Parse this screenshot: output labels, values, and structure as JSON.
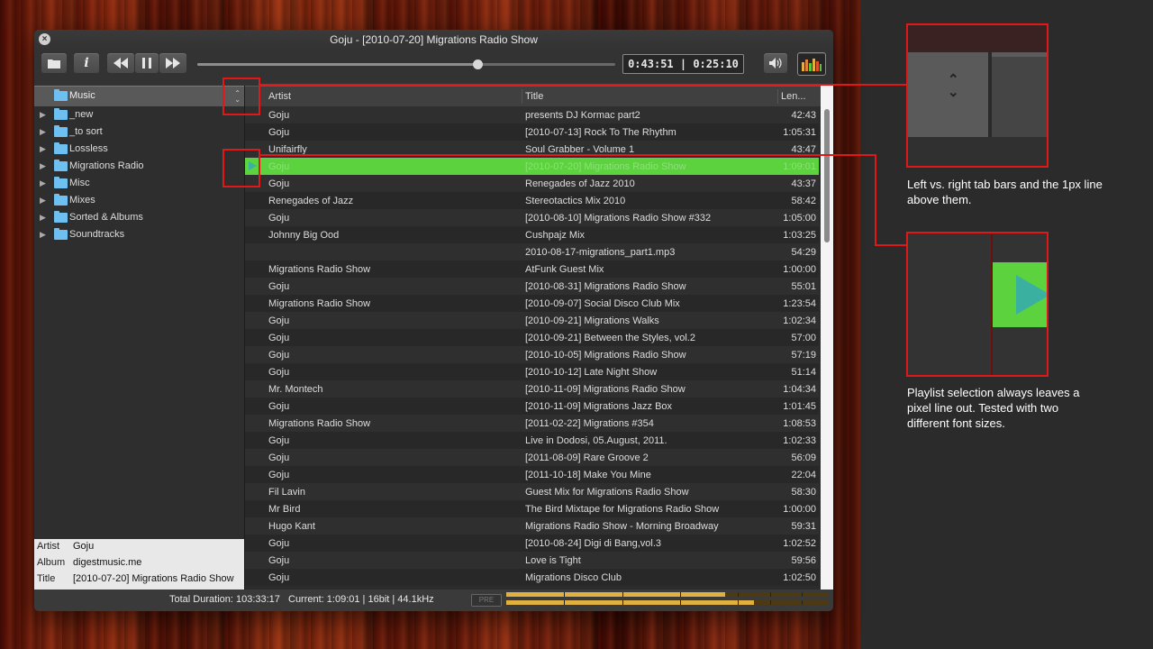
{
  "window": {
    "title": "Goju - [2010-07-20] Migrations Radio Show",
    "close_glyph": "×"
  },
  "toolbar": {
    "open_icon": "folder-icon",
    "info_icon": "info-icon",
    "prev_icon": "rewind-icon",
    "pause_icon": "pause-icon",
    "next_icon": "fast-forward-icon",
    "volume_icon": "speaker-icon",
    "visualizer_icon": "equalizer-icon",
    "seek_progress": 0.67,
    "time_display": "0:43:51 | 0:25:10"
  },
  "library": {
    "header_label": "Music",
    "items": [
      {
        "label": "_new"
      },
      {
        "label": "_to sort"
      },
      {
        "label": "Lossless"
      },
      {
        "label": "Migrations Radio"
      },
      {
        "label": "Misc"
      },
      {
        "label": "Mixes"
      },
      {
        "label": "Sorted & Albums"
      },
      {
        "label": "Soundtracks"
      }
    ]
  },
  "track_info": {
    "artist_key": "Artist",
    "artist_val": "Goju",
    "album_key": "Album",
    "album_val": "digestmusic.me",
    "title_key": "Title",
    "title_val": "[2010-07-20] Migrations Radio Show"
  },
  "playlist": {
    "columns": {
      "artist": "Artist",
      "title": "Title",
      "length": "Len..."
    },
    "rows": [
      {
        "artist": "Goju",
        "title": "presents DJ Kormac part2",
        "length": "42:43"
      },
      {
        "artist": "Goju",
        "title": "[2010-07-13] Rock To The Rhythm",
        "length": "1:05:31"
      },
      {
        "artist": "Unifairfly",
        "title": "Soul Grabber - Volume 1",
        "length": "43:47"
      },
      {
        "artist": "Goju",
        "title": "[2010-07-20] Migrations Radio Show",
        "length": "1:09:01"
      },
      {
        "artist": "Goju",
        "title": "Renegades of Jazz 2010",
        "length": "43:37"
      },
      {
        "artist": "Renegades of Jazz",
        "title": "Stereotactics Mix 2010",
        "length": "58:42"
      },
      {
        "artist": "Goju",
        "title": "[2010-08-10] Migrations Radio Show #332",
        "length": "1:05:00"
      },
      {
        "artist": "Johnny Big Ood",
        "title": "Cushpajz Mix",
        "length": "1:03:25"
      },
      {
        "artist": "",
        "title": "2010-08-17-migrations_part1.mp3",
        "length": "54:29"
      },
      {
        "artist": "Migrations Radio Show",
        "title": "AtFunk Guest Mix",
        "length": "1:00:00"
      },
      {
        "artist": "Goju",
        "title": "[2010-08-31] Migrations Radio Show",
        "length": "55:01"
      },
      {
        "artist": "Migrations Radio Show",
        "title": "[2010-09-07] Social Disco Club Mix",
        "length": "1:23:54"
      },
      {
        "artist": "Goju",
        "title": "[2010-09-21] Migrations Walks",
        "length": "1:02:34"
      },
      {
        "artist": "Goju",
        "title": "[2010-09-21] Between the Styles, vol.2",
        "length": "57:00"
      },
      {
        "artist": "Goju",
        "title": "[2010-10-05] Migrations Radio Show",
        "length": "57:19"
      },
      {
        "artist": "Goju",
        "title": "[2010-10-12] Late Night Show",
        "length": "51:14"
      },
      {
        "artist": "Mr. Montech",
        "title": "[2010-11-09] Migrations Radio Show",
        "length": "1:04:34"
      },
      {
        "artist": "Goju",
        "title": "[2010-11-09] Migrations Jazz Box",
        "length": "1:01:45"
      },
      {
        "artist": "Migrations Radio Show",
        "title": "[2011-02-22] Migrations #354",
        "length": "1:08:53"
      },
      {
        "artist": "Goju",
        "title": "Live in Dodosi, 05.August, 2011.",
        "length": "1:02:33"
      },
      {
        "artist": "Goju",
        "title": "[2011-08-09] Rare Groove 2",
        "length": "56:09"
      },
      {
        "artist": "Goju",
        "title": "[2011-10-18] Make You Mine",
        "length": "22:04"
      },
      {
        "artist": "Fil Lavin",
        "title": "Guest Mix for Migrations Radio Show",
        "length": "58:30"
      },
      {
        "artist": "Mr Bird",
        "title": "The Bird Mixtape for Migrations Radio Show",
        "length": "1:00:00"
      },
      {
        "artist": "Hugo Kant",
        "title": "Migrations Radio Show - Morning Broadway",
        "length": "59:31"
      },
      {
        "artist": "Goju",
        "title": "[2010-08-24] Digi di Bang,vol.3",
        "length": "1:02:52"
      },
      {
        "artist": "Goju",
        "title": "Love is Tight",
        "length": "59:56"
      },
      {
        "artist": "Goju",
        "title": "Migrations Disco Club",
        "length": "1:02:50"
      }
    ],
    "selected_index": 3
  },
  "status": {
    "total": "Total Duration: 103:33:17",
    "current": "Current: 1:09:01 | 16bit | 44.1kHz",
    "pre_label": "PRE",
    "meter_left": 0.68,
    "meter_right": 0.77
  },
  "annotations": {
    "caption1": "Left vs. right tab bars and  the 1px line above them.",
    "caption2": "Playlist selection always leaves a pixel line out. Tested with two different font sizes.",
    "accent": "#e01818"
  }
}
